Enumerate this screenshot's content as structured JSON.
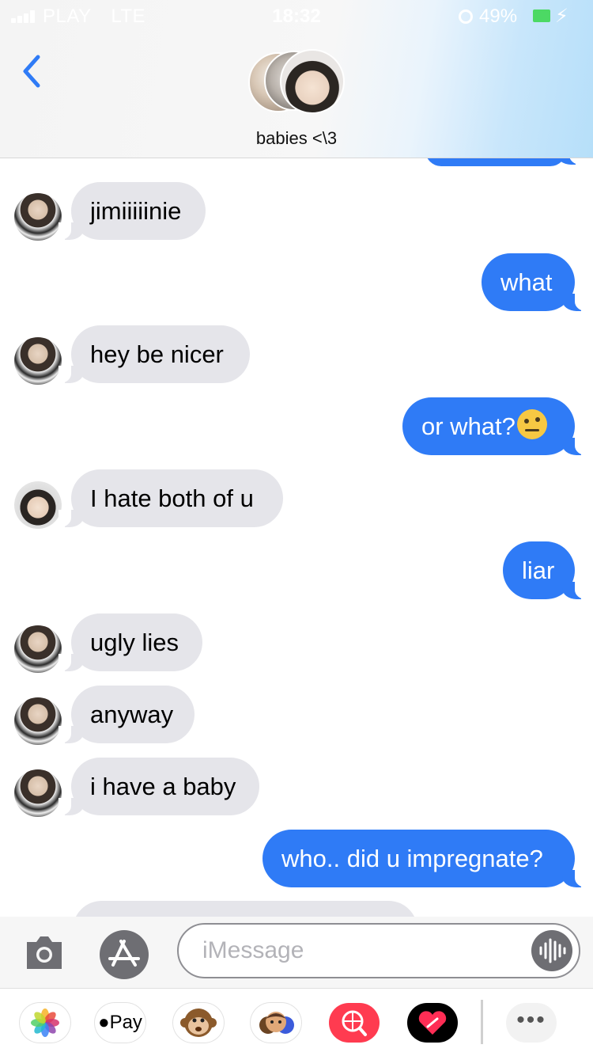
{
  "status_bar": {
    "carrier": "PLAY",
    "network": "LTE",
    "time": "18:32",
    "battery": "49%"
  },
  "header": {
    "group_name": "babies <\\3"
  },
  "messages": [
    {
      "direction": "incoming",
      "sender_avatar": "avatar-a",
      "text": "jimiiiiinie"
    },
    {
      "direction": "outgoing",
      "text": "what"
    },
    {
      "direction": "incoming",
      "sender_avatar": "avatar-a",
      "text": "hey be nicer"
    },
    {
      "direction": "outgoing",
      "text": "or what?",
      "emoji": "raised-eyebrow-face"
    },
    {
      "direction": "incoming",
      "sender_avatar": "avatar-b",
      "text": "I hate both of u"
    },
    {
      "direction": "outgoing",
      "text": "liar"
    },
    {
      "direction": "incoming",
      "sender_avatar": "avatar-a",
      "text": "ugly lies"
    },
    {
      "direction": "incoming",
      "sender_avatar": "avatar-a",
      "text": "anyway"
    },
    {
      "direction": "incoming",
      "sender_avatar": "avatar-a",
      "text": "i have a baby"
    },
    {
      "direction": "outgoing",
      "text": "who.. did u impregnate?"
    }
  ],
  "composer": {
    "placeholder": "iMessage",
    "value": ""
  },
  "app_drawer": {
    "apple_pay_label": "Pay",
    "apps": [
      "photos",
      "apple-pay",
      "memoji-monkey",
      "memoji-people",
      "web-image-search",
      "digital-touch-heart",
      "more"
    ]
  },
  "colors": {
    "outgoing_bubble": "#2f7bf6",
    "incoming_bubble": "#e5e5ea",
    "accent": "#2f7bf6"
  }
}
